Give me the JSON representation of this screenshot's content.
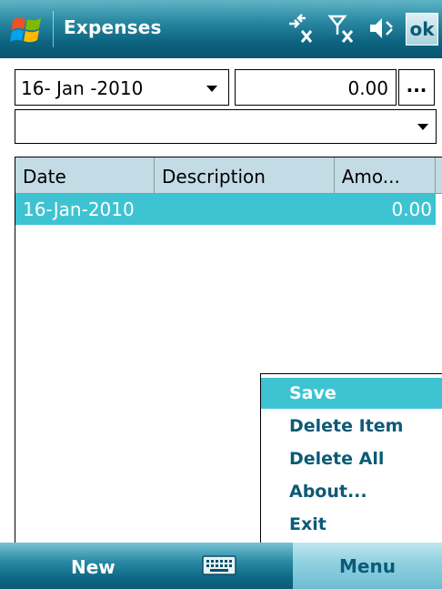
{
  "titlebar": {
    "title": "Expenses",
    "ok_label": "ok",
    "icons": [
      "start-logo-icon",
      "connectivity-off-icon",
      "signal-off-icon",
      "volume-icon"
    ]
  },
  "form": {
    "date_value": "16- Jan -2010",
    "amount_value": "0.00",
    "ellipsis_label": "...",
    "description_value": ""
  },
  "list": {
    "columns": [
      "Date",
      "Description",
      "Amo..."
    ],
    "rows": [
      {
        "date": "16-Jan-2010",
        "description": "",
        "amount": "0.00",
        "selected": true
      }
    ]
  },
  "menu": {
    "items": [
      {
        "label": "Save",
        "selected": true
      },
      {
        "label": "Delete Item",
        "selected": false
      },
      {
        "label": "Delete All",
        "selected": false
      },
      {
        "label": "About...",
        "selected": false
      },
      {
        "label": "Exit",
        "selected": false
      }
    ]
  },
  "softkeys": {
    "left": "New",
    "right": "Menu",
    "center_icon": "keyboard-icon"
  },
  "colors": {
    "title_bar": "#0e6683",
    "selection": "#3ec3d2",
    "header": "#c3dbe5",
    "menu_text": "#0c5a76"
  }
}
